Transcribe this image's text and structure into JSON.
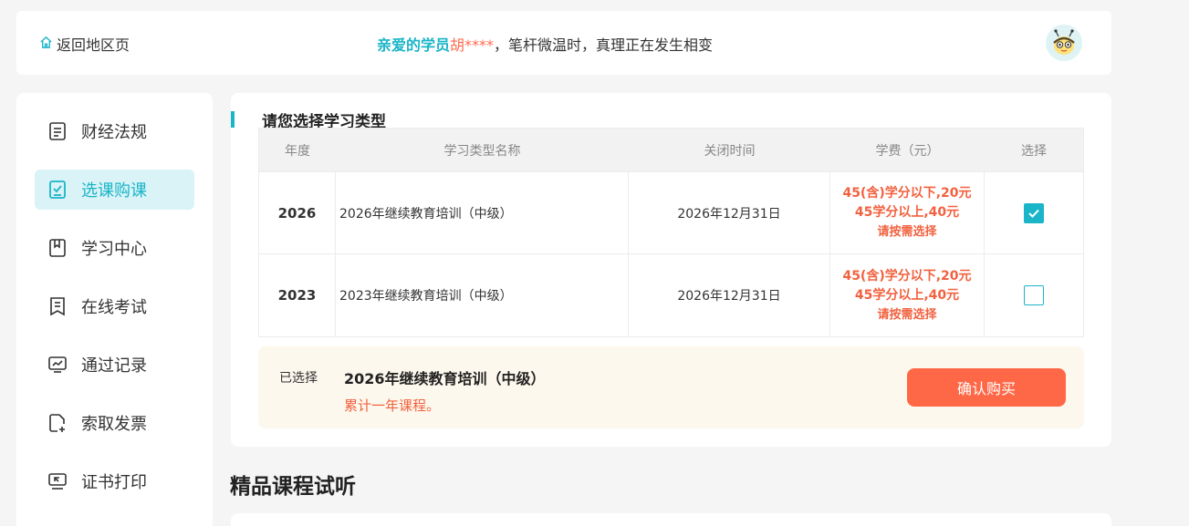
{
  "header": {
    "back_label": "返回地区页",
    "greeting_hello": "亲爱的学员",
    "user_name": "胡****",
    "greeting_rest": "，笔杆微温时，真理正在发生相变"
  },
  "sidebar": {
    "items": [
      {
        "label": "财经法规",
        "icon": "document-list-icon",
        "active": false
      },
      {
        "label": "选课购课",
        "icon": "checkbox-select-icon",
        "active": true
      },
      {
        "label": "学习中心",
        "icon": "bookmark-book-icon",
        "active": false
      },
      {
        "label": "在线考试",
        "icon": "exam-paper-icon",
        "active": false
      },
      {
        "label": "通过记录",
        "icon": "chart-monitor-icon",
        "active": false
      },
      {
        "label": "索取发票",
        "icon": "invoice-add-icon",
        "active": false
      },
      {
        "label": "证书打印",
        "icon": "printer-icon",
        "active": false
      }
    ]
  },
  "course_select": {
    "title": "请您选择学习类型",
    "columns": [
      "年度",
      "学习类型名称",
      "关闭时间",
      "学费（元）",
      "选择"
    ],
    "rows": [
      {
        "year": "2026",
        "name": "2026年继续教育培训（中级）",
        "close_time": "2026年12月31日",
        "fee_line1": "45(含)学分以下,20元",
        "fee_line2": "45学分以上,40元",
        "fee_note": "请按需选择",
        "checked": true
      },
      {
        "year": "2023",
        "name": "2023年继续教育培训（中级）",
        "close_time": "2026年12月31日",
        "fee_line1": "45(含)学分以下,20元",
        "fee_line2": "45学分以上,40元",
        "fee_note": "请按需选择",
        "checked": false
      }
    ]
  },
  "summary": {
    "selected_label": "已选择",
    "selected_course": "2026年继续教育培训（中级）",
    "note": "累计一年课程。",
    "buy_label": "确认购买"
  },
  "trial": {
    "title": "精品课程试听"
  },
  "colors": {
    "accent": "#1ab5c8",
    "price": "#f2613f",
    "button": "#ff6846",
    "summary_bg": "#fdf8ed"
  }
}
